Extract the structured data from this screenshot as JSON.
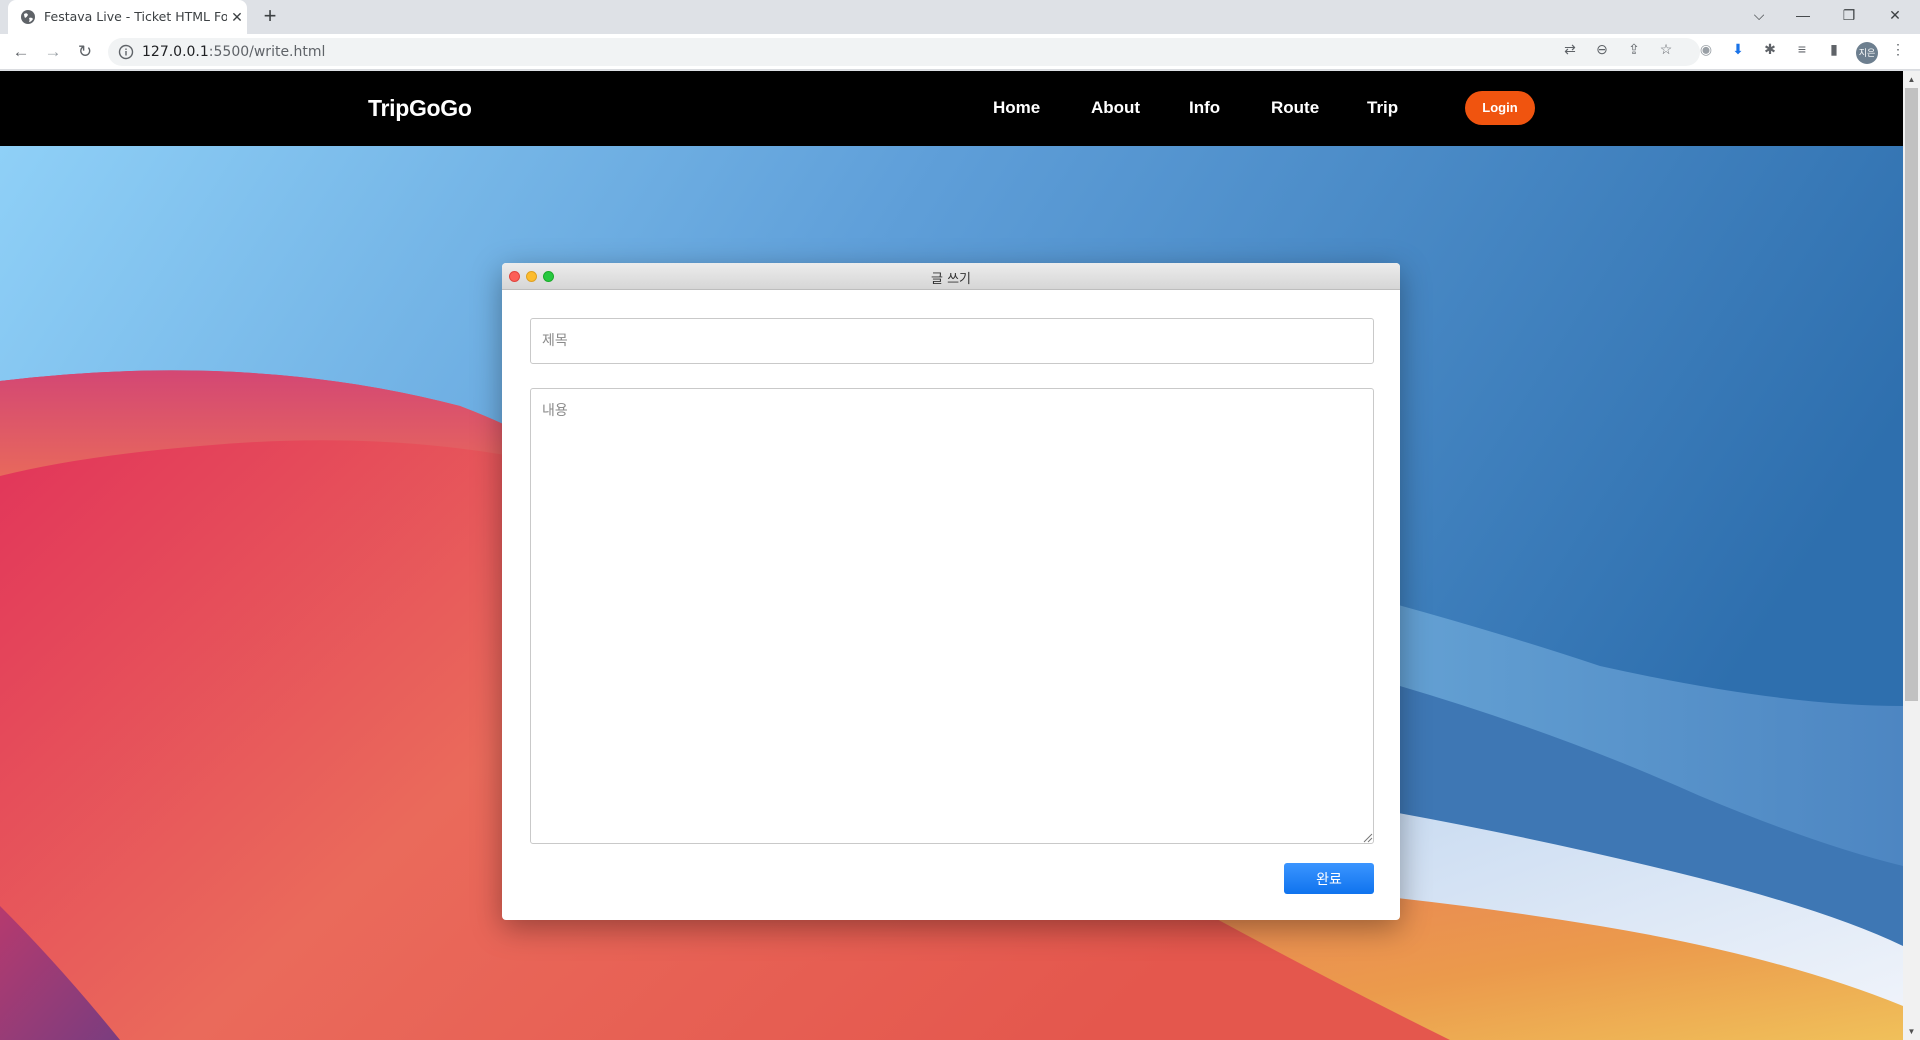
{
  "browser": {
    "tab_title": "Festava Live - Ticket HTML Form",
    "url_host": "127.0.0.1",
    "url_rest": ":5500/write.html",
    "profile_initials": "지은",
    "icons": [
      "globe-icon",
      "close-icon",
      "plus-icon",
      "back-icon",
      "forward-icon",
      "reload-icon",
      "info-icon",
      "translate-icon",
      "zoom-out-icon",
      "share-icon",
      "star-icon",
      "extension-icon",
      "download-icon",
      "puzzle-icon",
      "reading-list-icon",
      "sidepanel-icon",
      "menu-icon"
    ]
  },
  "site": {
    "brand": "TripGoGo",
    "nav": {
      "home": "Home",
      "about": "About",
      "info": "Info",
      "route": "Route",
      "trip": "Trip"
    },
    "login": "Login",
    "accent_color": "#f0540f"
  },
  "window": {
    "title": "글 쓰기",
    "title_placeholder": "제목",
    "content_placeholder": "내용",
    "submit_label": "완료",
    "submit_color": "#1a7ff5"
  }
}
